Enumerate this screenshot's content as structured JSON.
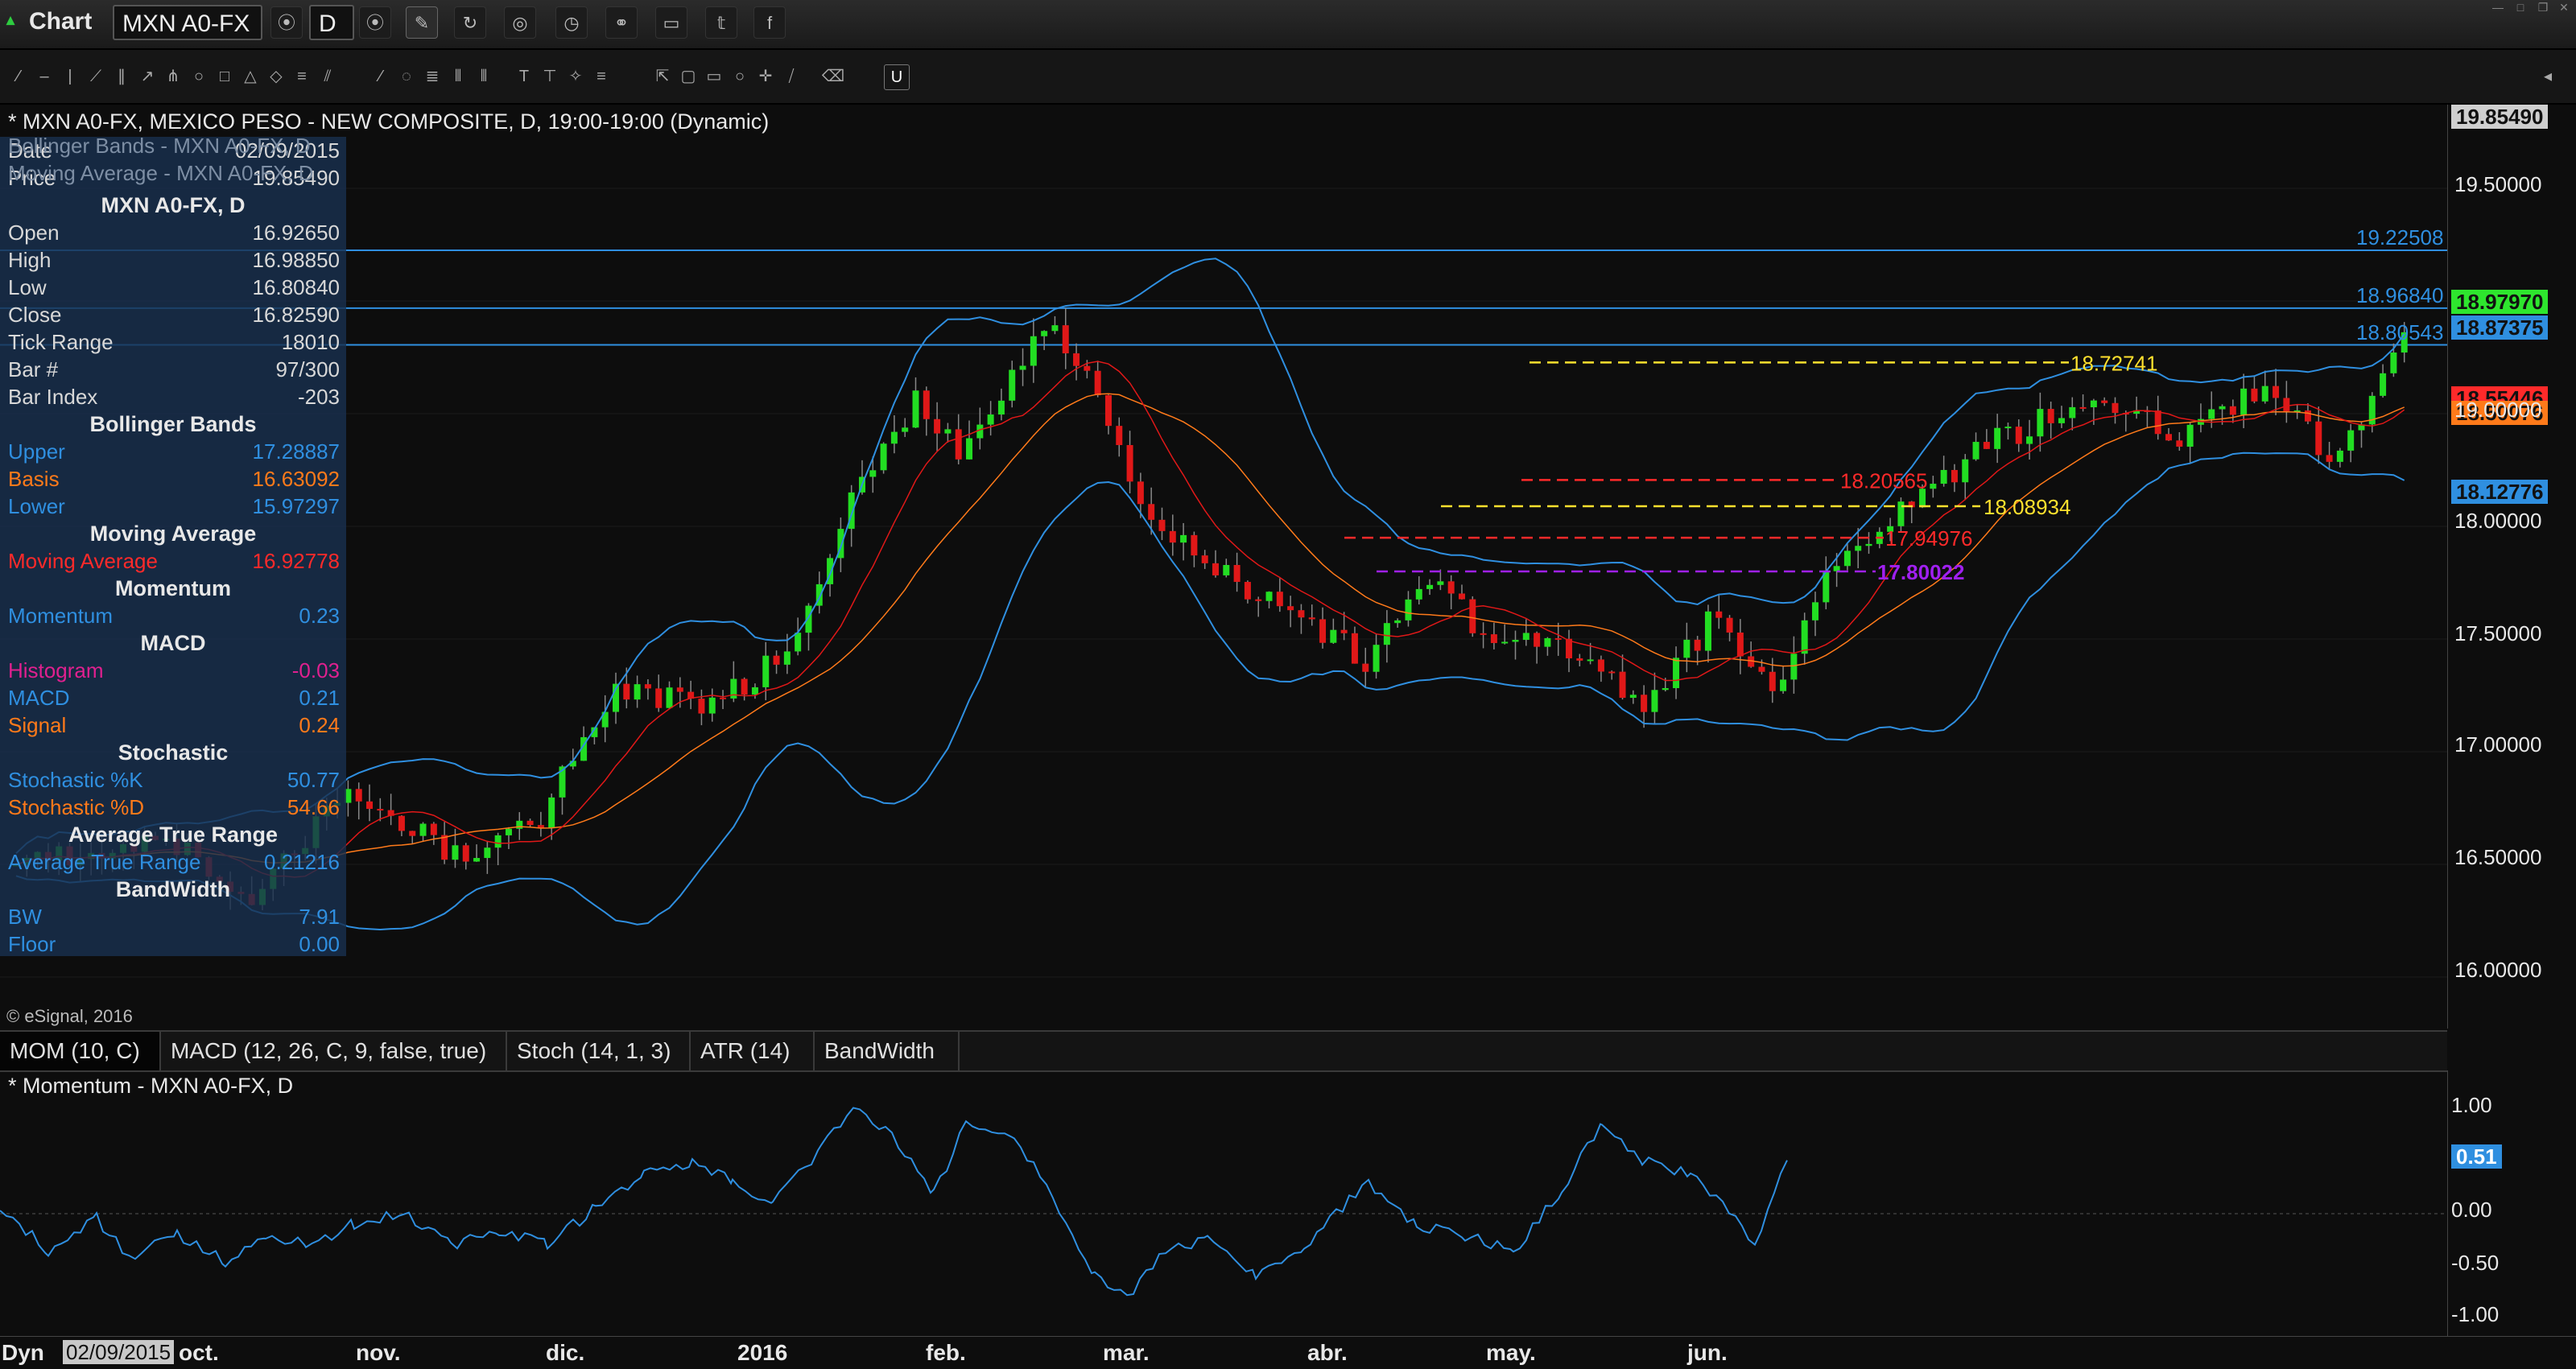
{
  "app": {
    "title": "Chart",
    "logo_text": "▴"
  },
  "toolbar": {
    "symbol": "MXN A0-FX",
    "interval": "D"
  },
  "chart": {
    "description": "* MXN A0-FX, MEXICO PESO - NEW COMPOSITE, D, 19:00-19:00 (Dynamic)",
    "copyright": "© eSignal, 2016",
    "price_axis_labels": [
      "19.50000",
      "19.00000",
      "18.50000",
      "18.00000",
      "17.50000",
      "17.00000",
      "16.50000",
      "16.00000"
    ],
    "price_tags": [
      {
        "text": "19.85490",
        "bg": "#cfcfcf",
        "fg": "#111111"
      },
      {
        "text": "19.22508",
        "bg": "transparent",
        "fg": "#2f8fe0"
      },
      {
        "text": "18.96840",
        "bg": "transparent",
        "fg": "#2f8fe0"
      },
      {
        "text": "18.97970",
        "bg": "#2ee62e",
        "fg": "#111111"
      },
      {
        "text": "18.87375",
        "bg": "#2f8fe0",
        "fg": "#111111"
      },
      {
        "text": "18.80543",
        "bg": "transparent",
        "fg": "#2f8fe0"
      },
      {
        "text": "18.55446",
        "bg": "#ff2a2a",
        "fg": "#111111"
      },
      {
        "text": "18.50076",
        "bg": "#ff7a1a",
        "fg": "#111111"
      },
      {
        "text": "18.12776",
        "bg": "#2f8fe0",
        "fg": "#111111"
      }
    ],
    "level_labels": [
      {
        "text": "18.72741",
        "color": "#ffe12e"
      },
      {
        "text": "18.20565",
        "color": "#ff2a2a"
      },
      {
        "text": "18.08934",
        "color": "#ffe12e"
      },
      {
        "text": "17.94976",
        "color": "#ff2a2a"
      },
      {
        "text": "17.80022",
        "color": "#a020f0"
      }
    ],
    "date_labels": [
      "oct.",
      "nov.",
      "dic.",
      "2016",
      "feb.",
      "mar.",
      "abr.",
      "may.",
      "jun."
    ],
    "dyn_label": "Dyn",
    "current_date": "02/09/2015"
  },
  "info_panel": {
    "overlay_lines": [
      "Bollinger Bands - MXN A0-FX, D",
      "Moving Average - MXN A0-FX, D"
    ],
    "date_row": {
      "label": "Date",
      "value": "02/09/2015"
    },
    "price_row": {
      "label": "Price",
      "value": "19.85490"
    },
    "symbol_header": "MXN A0-FX, D",
    "rows": [
      {
        "label": "Open",
        "value": "16.92650"
      },
      {
        "label": "High",
        "value": "16.98850"
      },
      {
        "label": "Low",
        "value": "16.80840"
      },
      {
        "label": "Close",
        "value": "16.82590"
      },
      {
        "label": "Tick Range",
        "value": "18010"
      },
      {
        "label": "Bar #",
        "value": "97/300"
      },
      {
        "label": "Bar Index",
        "value": "-203"
      }
    ],
    "sections": [
      {
        "title": "Bollinger Bands",
        "rows": [
          {
            "label": "Upper",
            "value": "17.28887",
            "lc": "#2f8fe0",
            "vc": "#2f8fe0"
          },
          {
            "label": "Basis",
            "value": "16.63092",
            "lc": "#ff7a1a",
            "vc": "#ff7a1a"
          },
          {
            "label": "Lower",
            "value": "15.97297",
            "lc": "#2f8fe0",
            "vc": "#2f8fe0"
          }
        ]
      },
      {
        "title": "Moving Average",
        "rows": [
          {
            "label": "Moving Average",
            "value": "16.92778",
            "lc": "#ff2a2a",
            "vc": "#ff2a2a"
          }
        ]
      },
      {
        "title": "Momentum",
        "rows": [
          {
            "label": "Momentum",
            "value": "0.23",
            "lc": "#2f8fe0",
            "vc": "#2f8fe0"
          }
        ]
      },
      {
        "title": "MACD",
        "rows": [
          {
            "label": "Histogram",
            "value": "-0.03",
            "lc": "#e0208f",
            "vc": "#e0208f"
          },
          {
            "label": "MACD",
            "value": "0.21",
            "lc": "#2f8fe0",
            "vc": "#2f8fe0"
          },
          {
            "label": "Signal",
            "value": "0.24",
            "lc": "#ff7a1a",
            "vc": "#ff7a1a"
          }
        ]
      },
      {
        "title": "Stochastic",
        "rows": [
          {
            "label": "Stochastic %K",
            "value": "50.77",
            "lc": "#2f8fe0",
            "vc": "#2f8fe0"
          },
          {
            "label": "Stochastic %D",
            "value": "54.66",
            "lc": "#ff7a1a",
            "vc": "#ff7a1a"
          }
        ]
      },
      {
        "title": "Average True Range",
        "rows": [
          {
            "label": "Average True Range",
            "value": "0.21216",
            "lc": "#2f8fe0",
            "vc": "#2f8fe0"
          }
        ]
      },
      {
        "title": "BandWidth",
        "rows": [
          {
            "label": "BW",
            "value": "7.91",
            "lc": "#2f8fe0",
            "vc": "#2f8fe0"
          },
          {
            "label": "Floor",
            "value": "0.00",
            "lc": "#2f8fe0",
            "vc": "#2f8fe0"
          }
        ]
      }
    ]
  },
  "tabs": [
    "MOM (10, C)",
    "MACD (12, 26, C, 9, false, true)",
    "Stoch (14, 1, 3)",
    "ATR (14)",
    "BandWidth"
  ],
  "momentum": {
    "title": "* Momentum - MXN A0-FX, D",
    "axis_labels": [
      "1.00",
      "0.50",
      "0.00",
      "-0.50",
      "-1.00"
    ],
    "current_tag": "0.51"
  },
  "colors": {
    "up": "#22dd22",
    "down": "#e01818",
    "band": "#2f8fe0",
    "ma": "#e01818",
    "basis": "#ff7a1a"
  }
}
